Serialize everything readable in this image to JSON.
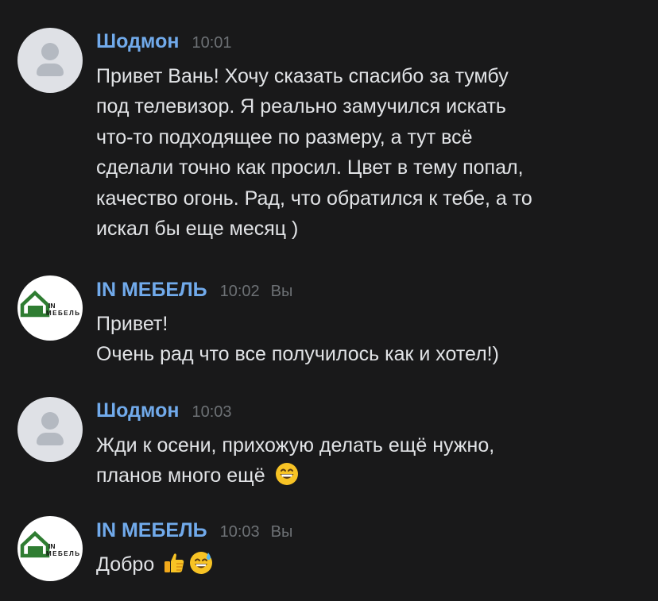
{
  "messages": [
    {
      "author": "Шодмон",
      "time": "10:01",
      "lines": [
        "Привет Вань! Хочу сказать спасибо за тумбу",
        "под телевизор. Я реально замучился искать",
        "что-то подходящее по размеру, а тут всё",
        "сделали точно как просил. Цвет в тему попал,",
        "качество огонь. Рад, что обратился к тебе, а то",
        "искал бы еще месяц )"
      ]
    },
    {
      "author": "IN МЕБЕЛЬ",
      "time": "10:02",
      "you_label": "Вы",
      "lines": [
        "Привет!",
        "Очень рад что все получилось как и хотел!)"
      ]
    },
    {
      "author": "Шодмон",
      "time": "10:03",
      "lines": [
        "Жди к осени, прихожую делать ещё нужно,",
        "планов много ещё"
      ],
      "emojis": [
        "grinning-face-emoji"
      ]
    },
    {
      "author": "IN МЕБЕЛЬ",
      "time": "10:03",
      "you_label": "Вы",
      "lines": [
        "Добро"
      ],
      "emojis": [
        "thumbs-up-emoji",
        "grinning-sweat-emoji"
      ]
    }
  ],
  "brand_logo": {
    "line1": "IN",
    "line2": "МЕБЕЛЬ",
    "color": "#2f7d32"
  },
  "colors": {
    "background": "#19191a",
    "author": "#71aaeb",
    "text": "#e1e3e6",
    "meta": "#6d7175"
  }
}
